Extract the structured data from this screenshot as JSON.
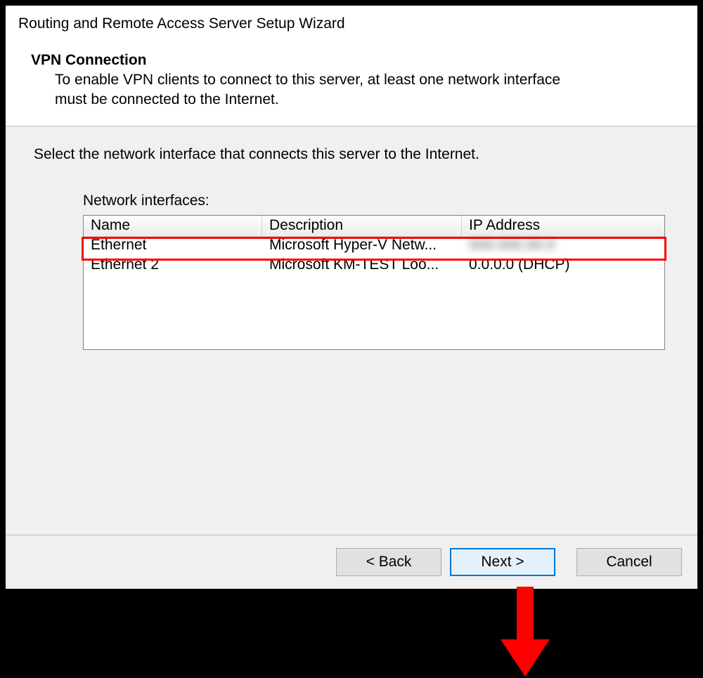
{
  "title": "Routing and Remote Access Server Setup Wizard",
  "header": {
    "subtitle": "VPN Connection",
    "description": "To enable VPN clients to connect to this server, at least one network interface must be connected to the Internet."
  },
  "body": {
    "instruction": "Select the network interface that connects this server to the Internet.",
    "list_label": "Network interfaces:",
    "columns": {
      "name": "Name",
      "description": "Description",
      "ip": "IP Address"
    },
    "rows": [
      {
        "name": "Ethernet",
        "description": "Microsoft Hyper-V Netw...",
        "ip": ""
      },
      {
        "name": "Ethernet 2",
        "description": "Microsoft KM-TEST Loo...",
        "ip": "0.0.0.0 (DHCP)"
      }
    ]
  },
  "buttons": {
    "back": "< Back",
    "next": "Next >",
    "cancel": "Cancel"
  },
  "annotation": {
    "highlighted_row_index": 0,
    "arrow_color": "#ff0000"
  }
}
